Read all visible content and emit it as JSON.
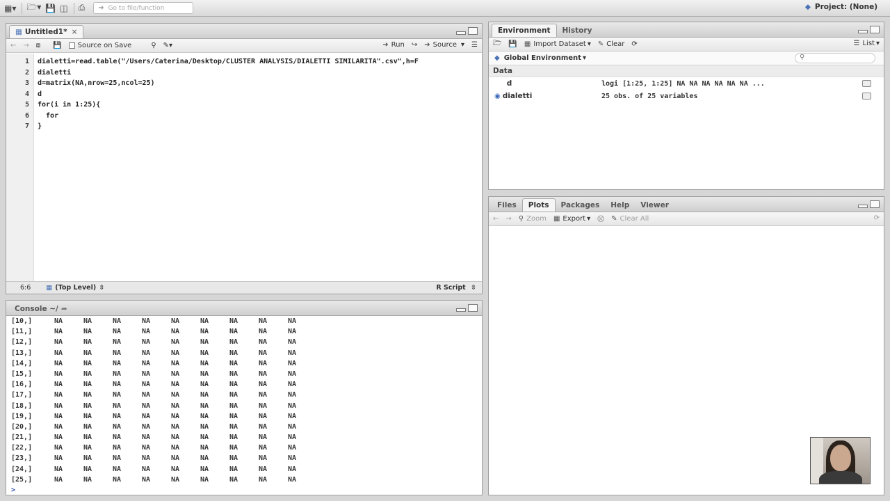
{
  "topbar": {
    "goto_placeholder": "Go to file/function",
    "project_label": "Project: (None)"
  },
  "source": {
    "tab_label": "Untitled1*",
    "source_on_save": "Source on Save",
    "run_label": "Run",
    "source_label": "Source",
    "line_numbers": [
      "1",
      "2",
      "3",
      "4",
      "5",
      "6",
      "7"
    ],
    "lines": [
      "dialetti=read.table(\"/Users/Caterina/Desktop/CLUSTER ANALYSIS/DIALETTI SIMILARITA\".csv\",h=F",
      "dialetti",
      "d=matrix(NA,nrow=25,ncol=25)",
      "d",
      "for(i in 1:25){",
      "  for",
      "}"
    ],
    "cursor_pos": "6:6",
    "scope": "(Top Level)",
    "language": "R Script"
  },
  "console": {
    "tab_label": "Console ~/",
    "rows": [
      {
        "label": "[10,]",
        "values": [
          "NA",
          "NA",
          "NA",
          "NA",
          "NA",
          "NA",
          "NA",
          "NA",
          "NA"
        ]
      },
      {
        "label": "[11,]",
        "values": [
          "NA",
          "NA",
          "NA",
          "NA",
          "NA",
          "NA",
          "NA",
          "NA",
          "NA"
        ]
      },
      {
        "label": "[12,]",
        "values": [
          "NA",
          "NA",
          "NA",
          "NA",
          "NA",
          "NA",
          "NA",
          "NA",
          "NA"
        ]
      },
      {
        "label": "[13,]",
        "values": [
          "NA",
          "NA",
          "NA",
          "NA",
          "NA",
          "NA",
          "NA",
          "NA",
          "NA"
        ]
      },
      {
        "label": "[14,]",
        "values": [
          "NA",
          "NA",
          "NA",
          "NA",
          "NA",
          "NA",
          "NA",
          "NA",
          "NA"
        ]
      },
      {
        "label": "[15,]",
        "values": [
          "NA",
          "NA",
          "NA",
          "NA",
          "NA",
          "NA",
          "NA",
          "NA",
          "NA"
        ]
      },
      {
        "label": "[16,]",
        "values": [
          "NA",
          "NA",
          "NA",
          "NA",
          "NA",
          "NA",
          "NA",
          "NA",
          "NA"
        ]
      },
      {
        "label": "[17,]",
        "values": [
          "NA",
          "NA",
          "NA",
          "NA",
          "NA",
          "NA",
          "NA",
          "NA",
          "NA"
        ]
      },
      {
        "label": "[18,]",
        "values": [
          "NA",
          "NA",
          "NA",
          "NA",
          "NA",
          "NA",
          "NA",
          "NA",
          "NA"
        ]
      },
      {
        "label": "[19,]",
        "values": [
          "NA",
          "NA",
          "NA",
          "NA",
          "NA",
          "NA",
          "NA",
          "NA",
          "NA"
        ]
      },
      {
        "label": "[20,]",
        "values": [
          "NA",
          "NA",
          "NA",
          "NA",
          "NA",
          "NA",
          "NA",
          "NA",
          "NA"
        ]
      },
      {
        "label": "[21,]",
        "values": [
          "NA",
          "NA",
          "NA",
          "NA",
          "NA",
          "NA",
          "NA",
          "NA",
          "NA"
        ]
      },
      {
        "label": "[22,]",
        "values": [
          "NA",
          "NA",
          "NA",
          "NA",
          "NA",
          "NA",
          "NA",
          "NA",
          "NA"
        ]
      },
      {
        "label": "[23,]",
        "values": [
          "NA",
          "NA",
          "NA",
          "NA",
          "NA",
          "NA",
          "NA",
          "NA",
          "NA"
        ]
      },
      {
        "label": "[24,]",
        "values": [
          "NA",
          "NA",
          "NA",
          "NA",
          "NA",
          "NA",
          "NA",
          "NA",
          "NA"
        ]
      },
      {
        "label": "[25,]",
        "values": [
          "NA",
          "NA",
          "NA",
          "NA",
          "NA",
          "NA",
          "NA",
          "NA",
          "NA"
        ]
      }
    ],
    "prompt": ">"
  },
  "environment": {
    "tabs": [
      "Environment",
      "History"
    ],
    "import_label": "Import Dataset",
    "clear_label": "Clear",
    "view_label": "List",
    "scope_label": "Global Environment",
    "section_label": "Data",
    "rows": [
      {
        "name": "d",
        "value": "logi [1:25, 1:25] NA NA NA NA NA NA ..."
      },
      {
        "name": "dialetti",
        "value": "25 obs. of 25 variables"
      }
    ]
  },
  "plots": {
    "tabs": [
      "Files",
      "Plots",
      "Packages",
      "Help",
      "Viewer"
    ],
    "zoom_label": "Zoom",
    "export_label": "Export",
    "clear_all_label": "Clear All"
  }
}
